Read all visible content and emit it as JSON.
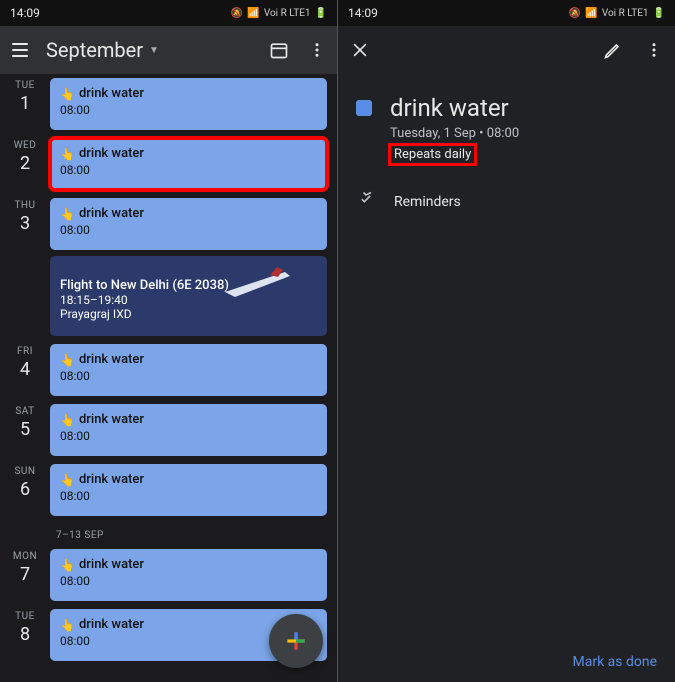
{
  "left": {
    "statusbar": {
      "time": "14:09",
      "indicators": "Voi R  LTE1"
    },
    "header": {
      "month": "September"
    },
    "days": [
      {
        "label": "TUE",
        "num": "1",
        "events": [
          {
            "title": "drink water",
            "time": "08:00",
            "highlight": false
          }
        ]
      },
      {
        "label": "WED",
        "num": "2",
        "events": [
          {
            "title": "drink water",
            "time": "08:00",
            "highlight": true
          }
        ]
      },
      {
        "label": "THU",
        "num": "3",
        "events": [
          {
            "title": "drink water",
            "time": "08:00"
          }
        ],
        "flight": {
          "title": "Flight to New Delhi (6E 2038)",
          "time": "18:15–19:40",
          "from": "Prayagraj IXD"
        }
      },
      {
        "label": "FRI",
        "num": "4",
        "events": [
          {
            "title": "drink water",
            "time": "08:00"
          }
        ]
      },
      {
        "label": "SAT",
        "num": "5",
        "events": [
          {
            "title": "drink water",
            "time": "08:00"
          }
        ]
      },
      {
        "label": "SUN",
        "num": "6",
        "events": [
          {
            "title": "drink water",
            "time": "08:00"
          }
        ]
      }
    ],
    "week_header": "7–13 SEP",
    "days2": [
      {
        "label": "MON",
        "num": "7",
        "events": [
          {
            "title": "drink water",
            "time": "08:00"
          }
        ]
      },
      {
        "label": "TUE",
        "num": "8",
        "events": [
          {
            "title": "drink water",
            "time": "08:00"
          }
        ]
      }
    ]
  },
  "right": {
    "statusbar": {
      "time": "14:09",
      "indicators": "Voi R  LTE1"
    },
    "title": "drink water",
    "subtitle": "Tuesday, 1 Sep • 08:00",
    "repeats": "Repeats daily",
    "reminders_label": "Reminders",
    "mark_done": "Mark as done"
  }
}
